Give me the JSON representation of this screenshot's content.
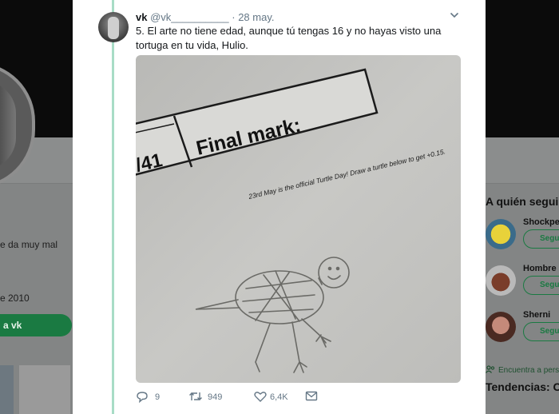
{
  "background_profile": {
    "bio_fragment": "e da muy mal",
    "joined_fragment": "e 2010",
    "follow_button_fragment": "a vk"
  },
  "sidebar": {
    "title": "A quién segui",
    "suggestions": [
      {
        "name": "Shockpe",
        "button": "Segu"
      },
      {
        "name": "Hombre",
        "button": "Segu"
      },
      {
        "name": "Sherni",
        "button": "Segu"
      }
    ],
    "find_people": "Encuentra a perso",
    "trends_title": "Tendencias: C"
  },
  "tweet": {
    "display_name": "vk",
    "handle": "@vk__________",
    "separator": "·",
    "date": "28 may.",
    "text": "5. El arte no tiene edad, aunque tú tengas 16 y no hayas visto una tortuga en tu vida, Hulio.",
    "photo": {
      "score_text": "/41",
      "final_mark_label": "Final mark:",
      "turtle_day_note": "23rd May is the official Turtle Day! Draw a turtle below to get +0.15."
    },
    "actions": {
      "replies": "9",
      "retweets": "949",
      "likes": "6,4K"
    }
  },
  "colors": {
    "accent_green": "#1a7a42",
    "thread_line": "#a8dcc6",
    "muted_text": "#657786"
  },
  "icons": [
    "reply-icon",
    "retweet-icon",
    "like-icon",
    "message-icon",
    "chevron-down-icon"
  ]
}
